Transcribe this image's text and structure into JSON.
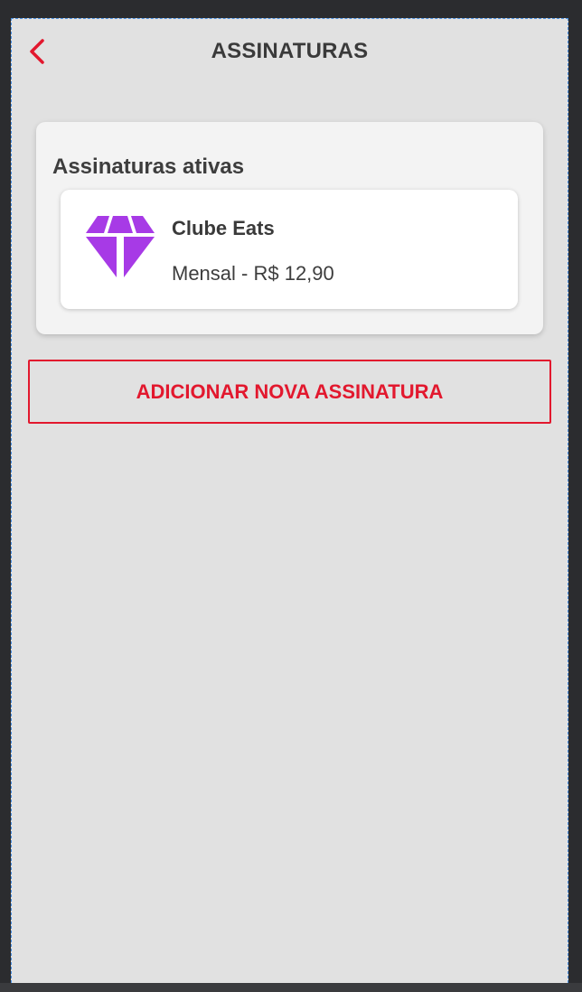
{
  "header": {
    "title": "ASSINATURAS",
    "back_icon": "chevron-left-icon"
  },
  "colors": {
    "accent": "#e2182e",
    "diamond": "#a73ae6",
    "background": "#e1e1e1",
    "card": "#f3f3f3"
  },
  "active_subscriptions": {
    "title": "Assinaturas ativas",
    "items": [
      {
        "icon": "diamond-icon",
        "name": "Clube Eats",
        "price": "Mensal - R$ 12,90"
      }
    ]
  },
  "actions": {
    "add_label": "ADICIONAR NOVA ASSINATURA"
  }
}
